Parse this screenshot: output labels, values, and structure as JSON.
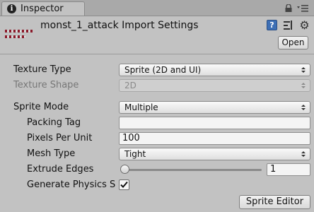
{
  "tab": {
    "icon": "info-icon",
    "label": "Inspector"
  },
  "header": {
    "title": "monst_1_attack Import Settings",
    "open_label": "Open",
    "icons": [
      "help-icon",
      "preset-icon",
      "gear-icon",
      "lock-icon",
      "menu-icon"
    ]
  },
  "fields": {
    "texture_type": {
      "label": "Texture Type",
      "value": "Sprite (2D and UI)"
    },
    "texture_shape": {
      "label": "Texture Shape",
      "value": "2D"
    },
    "sprite_mode": {
      "label": "Sprite Mode",
      "value": "Multiple"
    },
    "packing_tag": {
      "label": "Packing Tag",
      "value": ""
    },
    "pixels_per_unit": {
      "label": "Pixels Per Unit",
      "value": "100"
    },
    "mesh_type": {
      "label": "Mesh Type",
      "value": "Tight"
    },
    "extrude_edges": {
      "label": "Extrude Edges",
      "value": "1",
      "slider_fraction": 0.0
    },
    "generate_physics": {
      "label": "Generate Physics S",
      "checked": true
    }
  },
  "buttons": {
    "sprite_editor": "Sprite Editor"
  },
  "colors": {
    "panel": "#c2c2c2",
    "help_blue": "#3d6fb5"
  }
}
